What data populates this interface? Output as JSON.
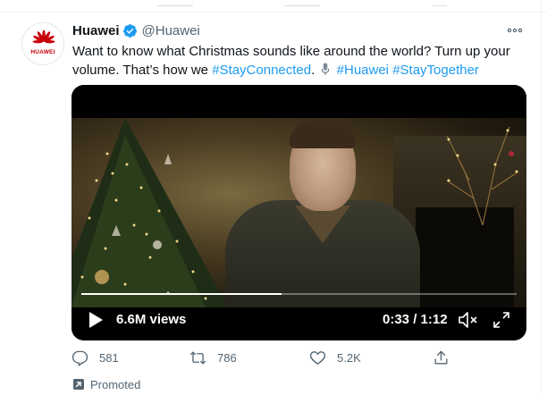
{
  "tweet": {
    "author_name": "Huawei",
    "handle": "@Huawei",
    "avatar_word": "HUAWEI",
    "text_part1": "Want to know what Christmas sounds like around the world? Turn up your volume. That’s how we ",
    "hashtag_stayconnected": "#StayConnected",
    "text_part2": ". ",
    "hashtag_huawei": "#Huawei",
    "hashtag_staytogether": "#StayTogether"
  },
  "video": {
    "views": "6.6M views",
    "time": "0:33 / 1:12",
    "progress": 0.46
  },
  "actions": {
    "replies": "581",
    "retweets": "786",
    "likes": "5.2K"
  },
  "promoted_label": "Promoted",
  "colors": {
    "accent": "#1d9bf0",
    "brand": "#c7000b",
    "secondary_text": "#536471"
  },
  "icons": [
    "verified-icon",
    "more-icon",
    "microphone-icon",
    "play-icon",
    "volume-muted-icon",
    "expand-icon",
    "reply-icon",
    "retweet-icon",
    "like-icon",
    "share-icon",
    "promoted-icon"
  ]
}
